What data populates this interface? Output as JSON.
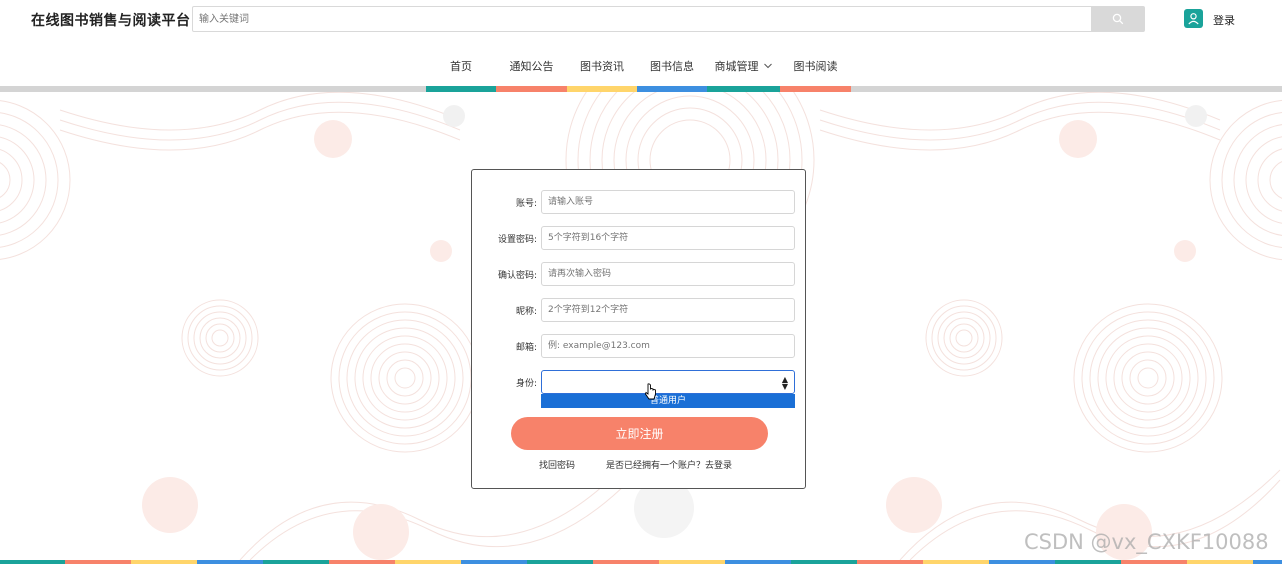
{
  "header": {
    "title": "在线图书销售与阅读平台",
    "search_placeholder": "输入关键词",
    "login_label": "登录"
  },
  "nav": {
    "items": [
      "首页",
      "通知公告",
      "图书资讯",
      "图书信息",
      "商城管理",
      "图书阅读"
    ],
    "colors": [
      "#1aa39a",
      "#f7826a",
      "#ffd56b",
      "#3d8fe0",
      "#1aa39a",
      "#f7826a"
    ]
  },
  "form": {
    "account_label": "账号:",
    "account_placeholder": "请输入账号",
    "password_label": "设置密码:",
    "password_placeholder": "5个字符到16个字符",
    "confirm_label": "确认密码:",
    "confirm_placeholder": "请再次输入密码",
    "nickname_label": "昵称:",
    "nickname_placeholder": "2个字符到12个字符",
    "email_label": "邮箱:",
    "email_placeholder": "例: example@123.com",
    "identity_label": "身份:",
    "identity_option": "普通用户",
    "register_button": "立即注册",
    "recover_link": "找回密码",
    "login_prompt": "是否已经拥有一个账户？去登录"
  },
  "watermark": "CSDN @vx_CXKF10088",
  "theme": {
    "accent": "#f7826a",
    "teal": "#1aa39a",
    "yellow": "#ffd56b",
    "blue": "#3d8fe0",
    "select_highlight": "#1a6fd6"
  }
}
